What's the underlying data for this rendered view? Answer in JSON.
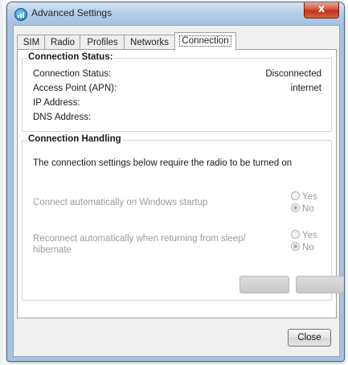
{
  "window": {
    "title": "Advanced Settings",
    "close_glyph": "x"
  },
  "tabs": [
    {
      "label": "SIM",
      "active": false
    },
    {
      "label": "Radio",
      "active": false
    },
    {
      "label": "Profiles",
      "active": false
    },
    {
      "label": "Networks",
      "active": false
    },
    {
      "label": "Connection",
      "active": true
    }
  ],
  "connection_status": {
    "title": "Connection Status:",
    "rows": [
      {
        "label": "Connection Status:",
        "value": "Disconnected"
      },
      {
        "label": "Access Point (APN):",
        "value": "internet"
      },
      {
        "label": "IP Address:",
        "value": ""
      },
      {
        "label": "DNS Address:",
        "value": ""
      }
    ]
  },
  "connection_handling": {
    "title": "Connection Handling",
    "info": "The connection settings below require the radio to be turned on",
    "options": [
      {
        "label": "Connect automatically on Windows startup",
        "yes": "Yes",
        "no": "No",
        "selected": "No"
      },
      {
        "label": "Reconnect automatically when returning from sleep/ hibernate",
        "yes": "Yes",
        "no": "No",
        "selected": "No"
      }
    ]
  },
  "buttons": {
    "close": "Close"
  },
  "icons": {
    "app": "signal-bars-icon",
    "close": "close-icon"
  }
}
